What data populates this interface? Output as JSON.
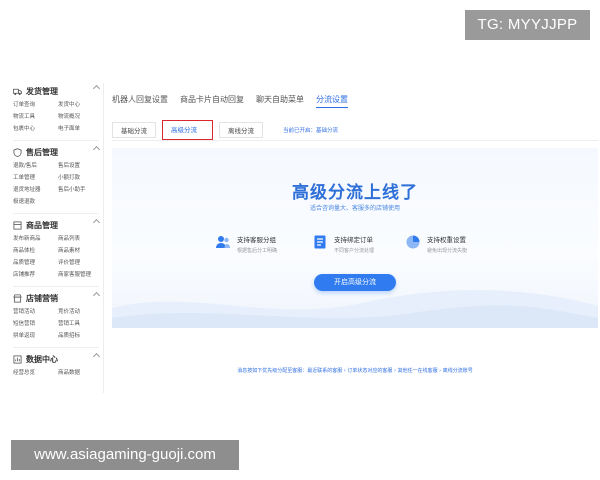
{
  "overlay": {
    "tg_badge": "TG: MYYJJPP",
    "url_banner": "www.asiagaming-guoji.com"
  },
  "sidebar": {
    "groups": [
      {
        "title": "发货管理",
        "icon": "truck-icon",
        "items": [
          "订单查询",
          "发货中心",
          "物流工具",
          "物流概况",
          "包裹中心",
          "电子面单"
        ]
      },
      {
        "title": "售后管理",
        "icon": "shield-icon",
        "items": [
          "退款/售后",
          "售后设置",
          "工单管理",
          "小额打款",
          "退货地址器",
          "售后小助手",
          "极速退款"
        ]
      },
      {
        "title": "商品管理",
        "icon": "box-icon",
        "items": [
          "发布新商品",
          "商品列表",
          "商品体检",
          "商品素材",
          "品质管理",
          "评价管理",
          "店铺推荐",
          "商家客服管理"
        ]
      },
      {
        "title": "店铺营销",
        "icon": "store-icon",
        "items": [
          "营销活动",
          "竞价活动",
          "短信营销",
          "营销工具",
          "拼单返现",
          "品质招标"
        ]
      },
      {
        "title": "数据中心",
        "icon": "chart-icon",
        "items": [
          "经营总览",
          "商品数据"
        ]
      }
    ]
  },
  "topnav": {
    "tabs": [
      "机器人回复设置",
      "商品卡片自动回复",
      "聊天自助菜单",
      "分流设置"
    ],
    "active_index": 3
  },
  "subtabs": {
    "items": [
      "基础分流",
      "高级分流",
      "离线分流"
    ],
    "highlight_index": 1,
    "status": "当前已开启：基础分流"
  },
  "hero": {
    "title": "高级分流上线了",
    "subtitle": "适合咨询量大、客服多的店铺使用",
    "features": [
      {
        "icon": "people-icon",
        "title": "支持客服分组",
        "desc": "根据售后分工明确"
      },
      {
        "icon": "document-icon",
        "title": "支持绑定订单",
        "desc": "不同客户分流处理"
      },
      {
        "icon": "pie-chart-icon",
        "title": "支持权重设置",
        "desc": "避免出现分流失衡"
      }
    ],
    "cta_label": "开启高级分流"
  },
  "footnote": "消息按如下优先级分配至客服：最近联系的客服 › 订单状态对应的客服 › 其他任一在线客服 › 离线分流账号",
  "colors": {
    "accent": "#2f7bef",
    "highlight_border": "#d9272e",
    "title_blue": "#2e6fd8"
  }
}
